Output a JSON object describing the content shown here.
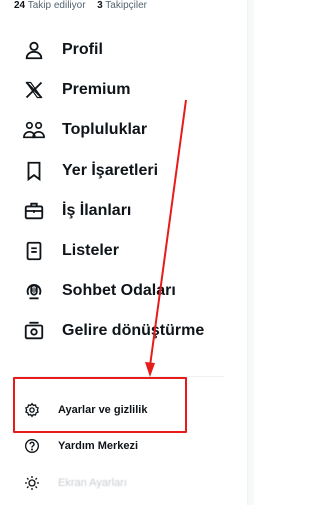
{
  "profile_stats": {
    "following_count": "24",
    "following_label": "Takip ediliyor",
    "followers_count": "3",
    "followers_label": "Takipçiler"
  },
  "menu": {
    "items": [
      {
        "label": "Profil",
        "icon": "person-icon"
      },
      {
        "label": "Premium",
        "icon": "x-logo-icon"
      },
      {
        "label": "Topluluklar",
        "icon": "communities-icon"
      },
      {
        "label": "Yer İşaretleri",
        "icon": "bookmark-icon"
      },
      {
        "label": "İş İlanları",
        "icon": "briefcase-icon"
      },
      {
        "label": "Listeler",
        "icon": "list-icon"
      },
      {
        "label": "Sohbet Odaları",
        "icon": "spaces-microphone-icon"
      },
      {
        "label": "Gelire dönüştürme",
        "icon": "monetization-icon"
      }
    ]
  },
  "settings_section": {
    "items": [
      {
        "label": "Ayarlar ve gizlilik",
        "icon": "gear-icon"
      },
      {
        "label": "Yardım Merkezi",
        "icon": "help-circle-icon"
      },
      {
        "label": "Ekran Ayarları",
        "icon": "sun-icon"
      }
    ]
  },
  "annotation": {
    "color": "#e81b1b",
    "highlight_target": "Ayarlar ve gizlilik"
  }
}
